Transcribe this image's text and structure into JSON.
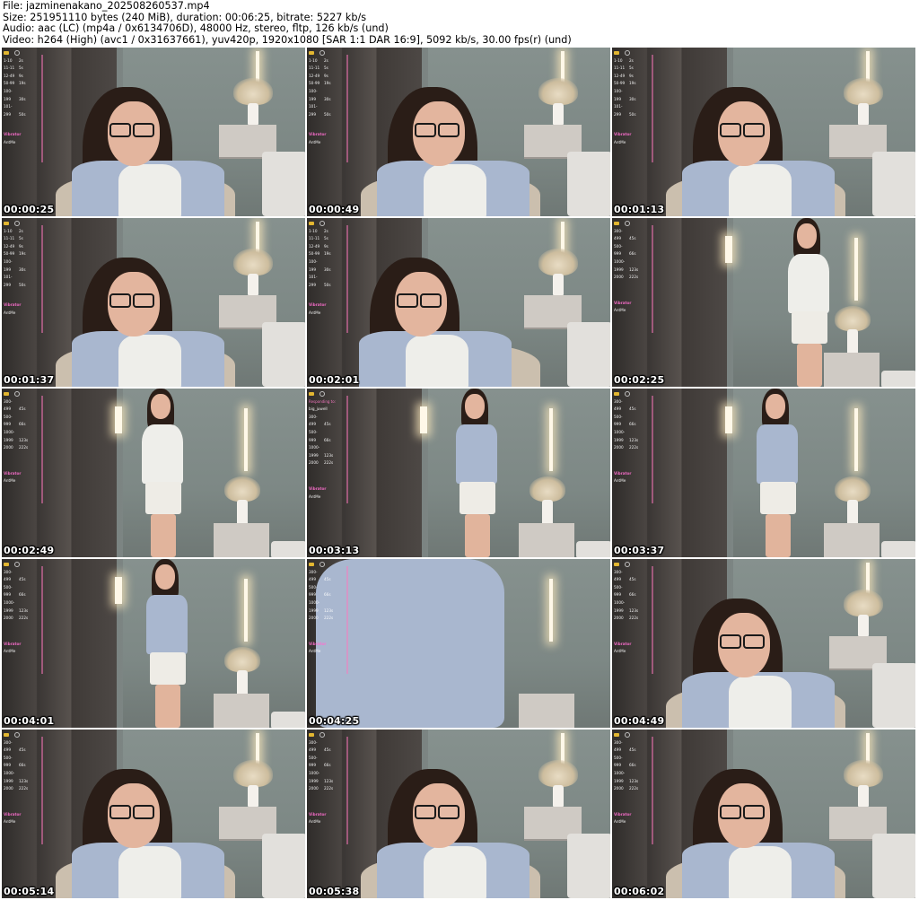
{
  "header": {
    "file_line": "File: jazminenakano_202508260537.mp4",
    "size_line": "Size: 251951110 bytes (240 MiB), duration: 00:06:25, bitrate: 5227 kb/s",
    "audio_line": "Audio: aac (LC) (mp4a / 0x6134706D), 48000 Hz, stereo, fltp, 126 kb/s (und)",
    "video_line": "Video: h264 (High) (avc1 / 0x31637661), yuv420p, 1920x1080 [SAR 1:1 DAR 16:9], 5092 kb/s, 30.00 fps(r) (und)"
  },
  "thumbnails": [
    {
      "timestamp": "00:00:25",
      "scene": "closeup"
    },
    {
      "timestamp": "00:00:49",
      "scene": "closeup"
    },
    {
      "timestamp": "00:01:13",
      "scene": "closeup"
    },
    {
      "timestamp": "00:01:37",
      "scene": "closeup"
    },
    {
      "timestamp": "00:02:01",
      "scene": "closeup"
    },
    {
      "timestamp": "00:02:25",
      "scene": "standing"
    },
    {
      "timestamp": "00:02:49",
      "scene": "standing"
    },
    {
      "timestamp": "00:03:13",
      "scene": "standing"
    },
    {
      "timestamp": "00:03:37",
      "scene": "standing"
    },
    {
      "timestamp": "00:04:01",
      "scene": "standing"
    },
    {
      "timestamp": "00:04:25",
      "scene": "fabric"
    },
    {
      "timestamp": "00:04:49",
      "scene": "closeup"
    },
    {
      "timestamp": "00:05:14",
      "scene": "closeup"
    },
    {
      "timestamp": "00:05:38",
      "scene": "closeup"
    },
    {
      "timestamp": "00:06:02",
      "scene": "closeup"
    }
  ],
  "overlay_menu": {
    "rows_a": [
      {
        "range": "1-10",
        "value": "2s"
      },
      {
        "range": "11-11",
        "value": "5s"
      },
      {
        "range": "12-49",
        "value": "9s"
      },
      {
        "range": "50-99",
        "value": "19s"
      },
      {
        "range": "100-199",
        "value": "30s"
      },
      {
        "range": "101-299",
        "value": "50s"
      }
    ],
    "rows_b": [
      {
        "range": "300-499",
        "value": "45s"
      },
      {
        "range": "500-999",
        "value": "66s"
      },
      {
        "range": "1000-1999",
        "value": "123s"
      },
      {
        "range": "2000",
        "value": "222s"
      }
    ],
    "tag": "Vibrator",
    "sub": "AntMe",
    "responding": "Responding to:",
    "responding_user": "big_juwell"
  },
  "colors": {
    "overlay_accent": "#ff6fd0",
    "timestamp_text": "#ffffff",
    "background": "#ffffff"
  }
}
